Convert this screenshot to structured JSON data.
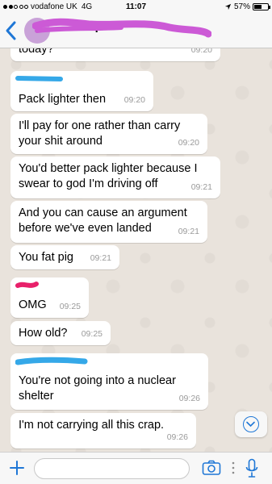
{
  "status_bar": {
    "carrier": "vodafone UK",
    "network": "4G",
    "time": "11:07",
    "battery": "57%",
    "battery_level": 0.57,
    "signal_bars": 2
  },
  "header": {
    "contact_name_visible": "osip",
    "back_icon": "chevron-left-icon"
  },
  "messages": [
    {
      "text": "today?",
      "time": "09:20"
    },
    {
      "text": "Pack lighter then",
      "time": "09:20"
    },
    {
      "text": "I'll pay for one rather than carry your shit around",
      "time": "09:20"
    },
    {
      "text": "You'd better pack lighter because I swear to god I'm driving off",
      "time": "09:21"
    },
    {
      "text": "And you can cause an argument before we've even landed",
      "time": "09:21"
    },
    {
      "text": "You fat pig",
      "time": "09:21"
    },
    {
      "text": "OMG",
      "time": "09:25"
    },
    {
      "text": "How old?",
      "time": "09:25"
    },
    {
      "text": "You're not going into a nuclear shelter",
      "time": "09:26"
    },
    {
      "text": "I'm not carrying all this crap.",
      "time": "09:26"
    }
  ],
  "input": {
    "placeholder": "",
    "icons": [
      "plus-icon",
      "camera-icon",
      "more-icon",
      "microphone-icon"
    ]
  },
  "colors": {
    "accent": "#1f77d6",
    "chat_bg": "#e9e3dc",
    "scribble_pink": "#cc5ad6",
    "scribble_blue": "#35a8e8",
    "scribble_red": "#e8206a"
  }
}
